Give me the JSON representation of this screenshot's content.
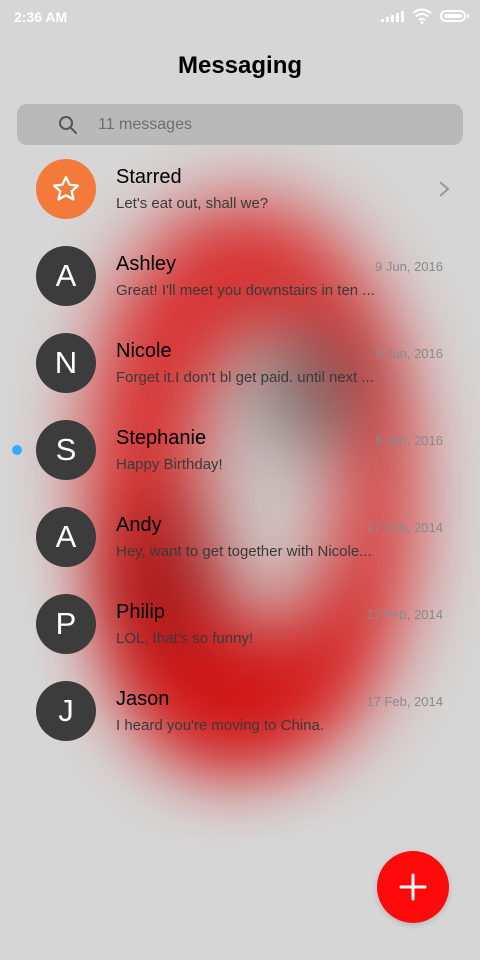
{
  "status_bar": {
    "time": "2:36 AM"
  },
  "header": {
    "title": "Messaging"
  },
  "search": {
    "placeholder": "11 messages"
  },
  "starred": {
    "avatar_icon": "star-icon",
    "name": "Starred",
    "snippet": "Let's eat out, shall we?"
  },
  "threads": [
    {
      "initial": "A",
      "name": "Ashley",
      "snippet": "Great! I'll meet you downstairs in ten ...",
      "date": "9 Jun, 2016",
      "unread": false
    },
    {
      "initial": "N",
      "name": "Nicole",
      "snippet": "Forget it.I don't bl get paid. until next ...",
      "date": "9 Jun, 2016",
      "unread": false
    },
    {
      "initial": "S",
      "name": "Stephanie",
      "snippet": "Happy Birthday!",
      "date": "8 Jun, 2016",
      "unread": true
    },
    {
      "initial": "A",
      "name": "Andy",
      "snippet": "Hey, want to get together with Nicole...",
      "date": "17 Feb, 2014",
      "unread": false
    },
    {
      "initial": "P",
      "name": "Philip",
      "snippet": "LOL, that's so funny!",
      "date": "17 Feb, 2014",
      "unread": false
    },
    {
      "initial": "J",
      "name": "Jason",
      "snippet": "I heard you're moving to China.",
      "date": "17 Feb, 2014",
      "unread": false
    }
  ],
  "colors": {
    "accent": "#ff0a0a",
    "starred_avatar": "#f47a3c",
    "avatar": "#3c3c3c",
    "unread_dot": "#33aaff"
  },
  "fab": {
    "icon": "plus-icon"
  }
}
